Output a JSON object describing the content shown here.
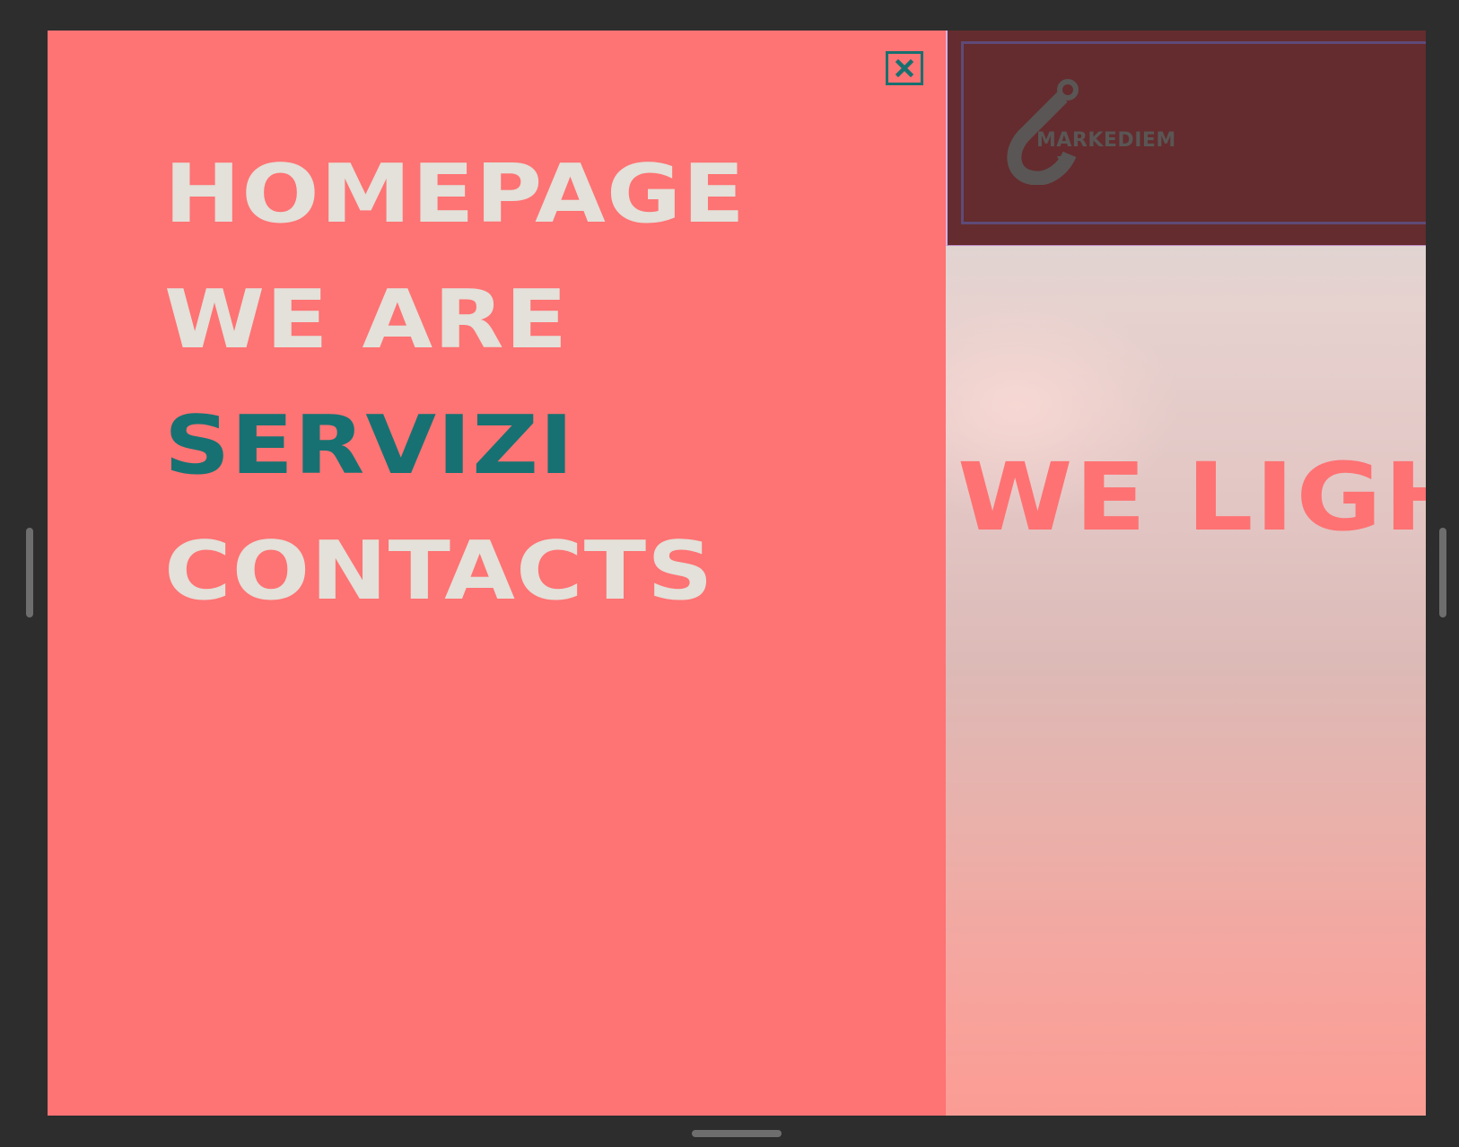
{
  "menu": {
    "items": [
      {
        "label": "HOMEPAGE",
        "active": false
      },
      {
        "label": "WE ARE",
        "active": false
      },
      {
        "label": "SERVIZI",
        "active": true
      },
      {
        "label": "CONTACTS",
        "active": false
      }
    ],
    "close_icon": "close-icon"
  },
  "header": {
    "logo_text": "MARKEDIEM",
    "logo_icon": "hook-icon"
  },
  "hero": {
    "title": "WE LIGHT"
  },
  "colors": {
    "menu_bg": "#fe7374",
    "menu_text": "#e3e1d9",
    "active_text": "#177172",
    "header_bg": "#642c2e",
    "hero_title": "#fe7273"
  }
}
